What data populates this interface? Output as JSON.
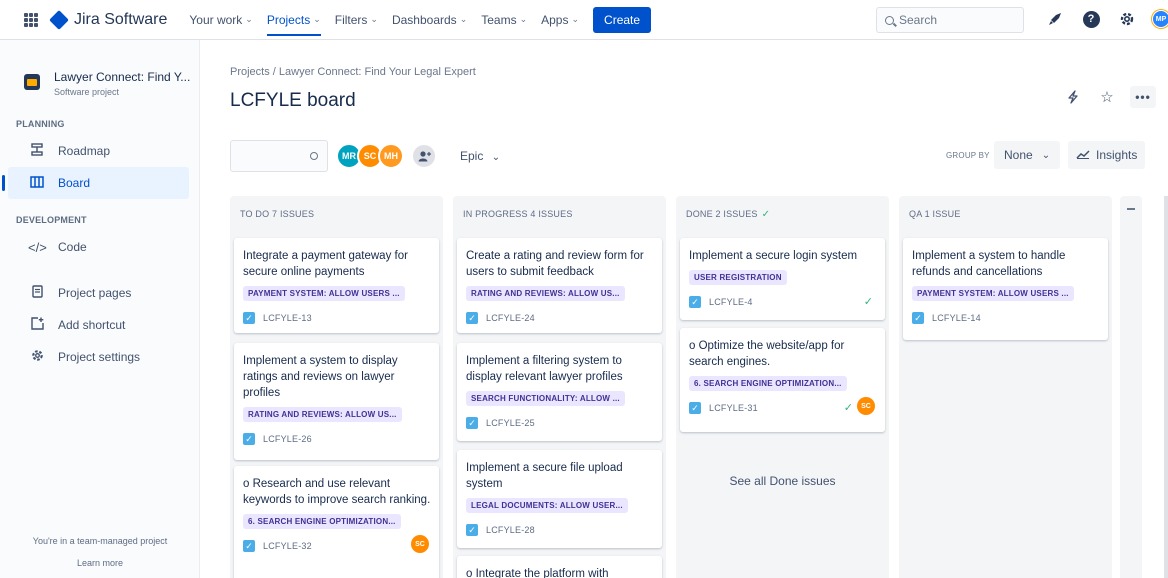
{
  "topnav": {
    "product": "Jira Software",
    "menu": [
      {
        "label": "Your work",
        "active": false
      },
      {
        "label": "Projects",
        "active": true
      },
      {
        "label": "Filters",
        "active": false
      },
      {
        "label": "Dashboards",
        "active": false
      },
      {
        "label": "Teams",
        "active": false
      },
      {
        "label": "Apps",
        "active": false
      }
    ],
    "create_label": "Create",
    "search_placeholder": "Search",
    "user_initials": "MP"
  },
  "sidebar": {
    "project_name": "Lawyer Connect: Find Y...",
    "project_type": "Software project",
    "planning_heading": "PLANNING",
    "development_heading": "DEVELOPMENT",
    "items": {
      "roadmap": "Roadmap",
      "board": "Board",
      "code": "Code",
      "project_pages": "Project pages",
      "add_shortcut": "Add shortcut",
      "project_settings": "Project settings"
    },
    "team_note": "You're in a team-managed project",
    "learn_more": "Learn more"
  },
  "main": {
    "breadcrumb": "Projects  /  Lawyer Connect: Find Your Legal Expert",
    "title": "LCFYLE board",
    "avatars": [
      "MR",
      "SC",
      "MH"
    ],
    "epic_label": "Epic",
    "group_by_label": "GROUP BY",
    "group_by_value": "None",
    "insights_label": "Insights"
  },
  "columns": {
    "todo": {
      "title": "TO DO 7 ISSUES",
      "cards": [
        {
          "title": "Integrate a payment gateway for secure online payments",
          "epic": "PAYMENT SYSTEM: ALLOW USERS ...",
          "key": "LCFYLE-13"
        },
        {
          "title": "Implement a system to display ratings and reviews on lawyer profiles",
          "epic": "RATING AND REVIEWS: ALLOW US...",
          "key": "LCFYLE-26"
        },
        {
          "title": "o Research and use relevant keywords to improve search ranking.",
          "epic": "6. SEARCH ENGINE OPTIMIZATION...",
          "key": "LCFYLE-32",
          "assignee": "SC"
        }
      ]
    },
    "inprogress": {
      "title": "IN PROGRESS 4 ISSUES",
      "cards": [
        {
          "title": "Create a rating and review form for users to submit feedback",
          "epic": "RATING AND REVIEWS: ALLOW US...",
          "key": "LCFYLE-24"
        },
        {
          "title": "Implement a filtering system to display relevant lawyer profiles",
          "epic": "SEARCH FUNCTIONALITY: ALLOW ...",
          "key": "LCFYLE-25"
        },
        {
          "title": "Implement a secure file upload system",
          "epic": "LEGAL DOCUMENTS: ALLOW USER...",
          "key": "LCFYLE-28"
        },
        {
          "title": "o Integrate the platform with"
        }
      ]
    },
    "done": {
      "title": "DONE 2 ISSUES",
      "cards": [
        {
          "title": "Implement a secure login system",
          "epic": "USER REGISTRATION",
          "key": "LCFYLE-4"
        },
        {
          "title": "o Optimize the website/app for search engines.",
          "epic": "6. SEARCH ENGINE OPTIMIZATION...",
          "key": "LCFYLE-31",
          "assignee": "SC"
        }
      ],
      "see_all": "See all Done issues"
    },
    "qa": {
      "title": "QA 1 ISSUE",
      "cards": [
        {
          "title": "Implement a system to handle refunds and cancellations",
          "epic": "PAYMENT SYSTEM: ALLOW USERS ...",
          "key": "LCFYLE-14"
        }
      ]
    }
  }
}
